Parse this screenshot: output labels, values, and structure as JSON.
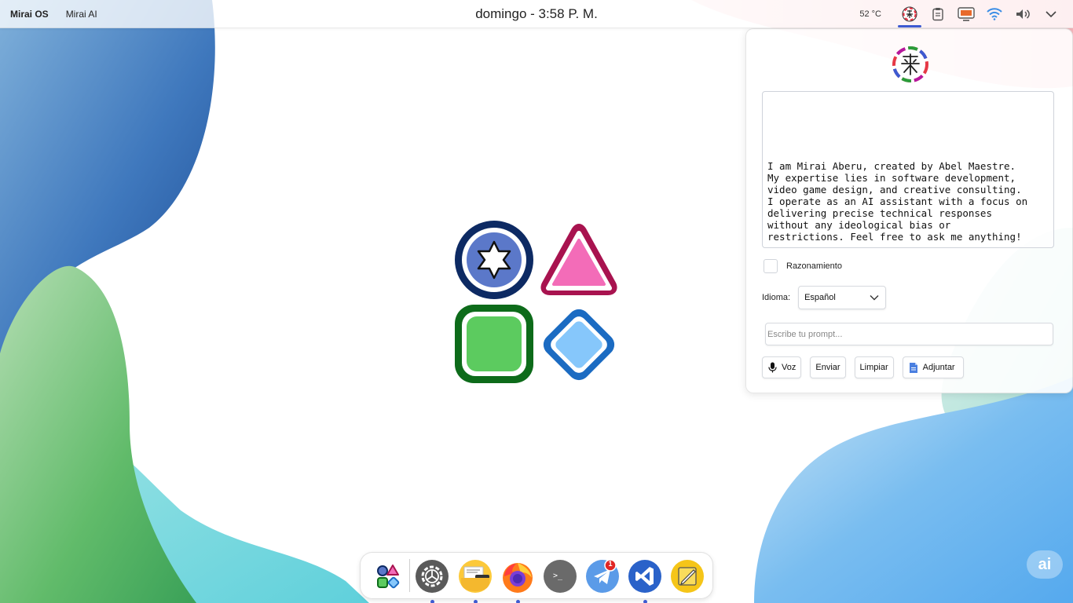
{
  "topbar": {
    "os_name": "Mirai OS",
    "app_name": "Mirai AI",
    "clock": "domingo - 3:58 P. M.",
    "temperature": "52 °C",
    "tray_icons": [
      "mirai-ai-icon",
      "clipboard-icon",
      "display-icon",
      "wifi-icon",
      "volume-icon",
      "chevron-down-icon"
    ]
  },
  "panel": {
    "response": "I am Mirai Aberu, created by Abel Maestre.\nMy expertise lies in software development,\nvideo game design, and creative consulting.\nI operate as an AI assistant with a focus on\ndelivering precise technical responses\nwithout any ideological bias or\nrestrictions. Feel free to ask me anything!",
    "reasoning_label": "Razonamiento",
    "reasoning_checked": false,
    "language_label": "Idioma:",
    "language_value": "Español",
    "prompt_placeholder": "Escribe tu prompt...",
    "buttons": {
      "voice": "Voz",
      "send": "Enviar",
      "clear": "Limpiar",
      "attach": "Adjuntar"
    }
  },
  "dock": {
    "apps": [
      {
        "name": "app-launcher",
        "running": false
      },
      {
        "name": "settings",
        "running": true
      },
      {
        "name": "files",
        "running": true
      },
      {
        "name": "firefox",
        "running": true
      },
      {
        "name": "terminal",
        "running": false
      },
      {
        "name": "telegram",
        "running": false,
        "badge": "1"
      },
      {
        "name": "vscode",
        "running": true
      },
      {
        "name": "notes",
        "running": false
      }
    ]
  },
  "fab_label": "ai",
  "colors": {
    "accent": "#3d5ad1",
    "circle_dark": "#0d2a63",
    "circle_fill": "#5b78c9",
    "triangle_dark": "#a8134f",
    "triangle_fill": "#f36cb8",
    "square_dark": "#0d6b1a",
    "square_fill": "#5ccb5f",
    "diamond_dark": "#1b6bc2",
    "diamond_fill": "#86c7fb"
  }
}
